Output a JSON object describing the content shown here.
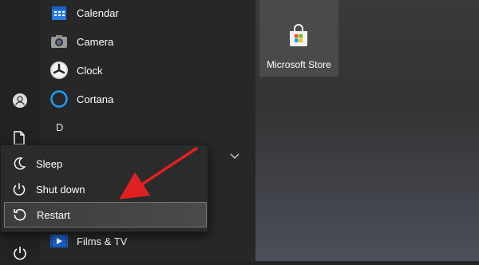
{
  "apps": [
    {
      "label": "Calendar",
      "icon": "calendar-icon"
    },
    {
      "label": "Camera",
      "icon": "camera-icon"
    },
    {
      "label": "Clock",
      "icon": "clock-icon"
    },
    {
      "label": "Cortana",
      "icon": "cortana-icon"
    }
  ],
  "section_letter": "D",
  "apps_bottom": [
    {
      "label": "Films & TV",
      "icon": "films-tv-icon"
    }
  ],
  "tile": {
    "label": "Microsoft Store",
    "icon": "microsoft-store-icon"
  },
  "power_menu": {
    "items": [
      {
        "label": "Sleep",
        "icon": "moon-icon"
      },
      {
        "label": "Shut down",
        "icon": "power-icon"
      },
      {
        "label": "Restart",
        "icon": "restart-icon",
        "selected": true
      }
    ]
  },
  "rail": {
    "user_icon": "user-icon",
    "documents_icon": "document-icon",
    "power_icon": "power-icon"
  },
  "colors": {
    "accent": "#0078d7",
    "arrow": "#e02020",
    "menu_bg": "#2b2b2b"
  }
}
